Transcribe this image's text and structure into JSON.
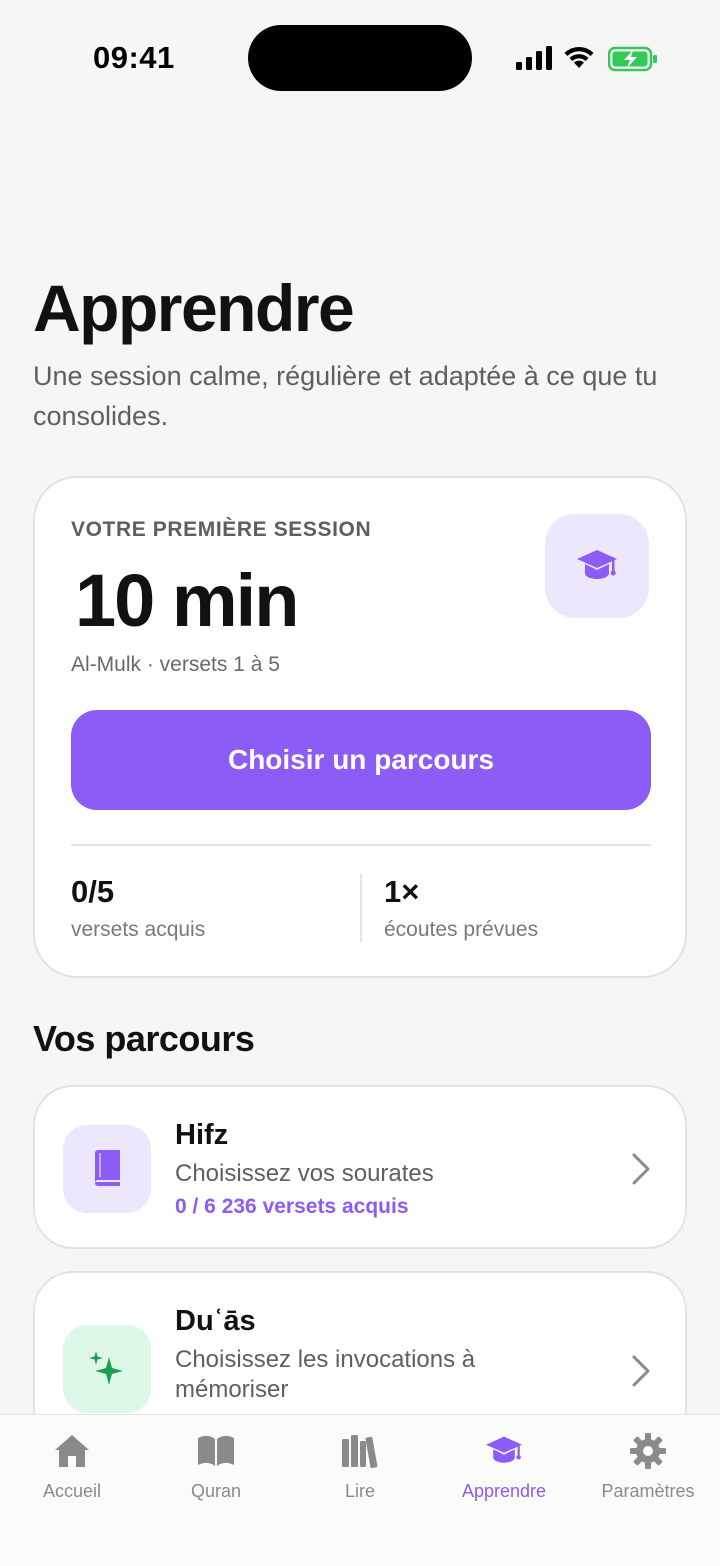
{
  "status_bar": {
    "time": "09:41"
  },
  "header": {
    "title": "Apprendre",
    "subtitle": "Une session calme, régulière et adaptée à ce que tu consolides."
  },
  "session_card": {
    "eyebrow": "VOTRE PREMIÈRE SESSION",
    "duration": "10 min",
    "meta": "Al-Mulk · versets 1 à 5",
    "badge_icon": "graduation-cap-icon",
    "cta_label": "Choisir un parcours",
    "stats": [
      {
        "value": "0/5",
        "label": "versets acquis"
      },
      {
        "value": "1×",
        "label": "écoutes prévues"
      }
    ]
  },
  "parcours": {
    "section_title": "Vos parcours",
    "items": [
      {
        "title": "Hifz",
        "description": "Choisissez vos sourates",
        "progress": "0 / 6 236 versets acquis",
        "icon": "book-icon"
      },
      {
        "title": "Duʿās",
        "description": "Choisissez les invocations à mémoriser",
        "icon": "sparkles-icon"
      }
    ]
  },
  "tab_bar": {
    "tabs": [
      {
        "label": "Accueil",
        "icon": "home-icon",
        "active": false
      },
      {
        "label": "Quran",
        "icon": "open-book-icon",
        "active": false
      },
      {
        "label": "Lire",
        "icon": "library-icon",
        "active": false
      },
      {
        "label": "Apprendre",
        "icon": "graduation-cap-icon",
        "active": true
      },
      {
        "label": "Paramètres",
        "icon": "gear-icon",
        "active": false
      }
    ]
  },
  "colors": {
    "accent": "#8b5cf6",
    "accent_soft": "#ede7fd",
    "green_soft": "#ddf8e6",
    "green_icon": "#1f9d55",
    "battery_green": "#34c759",
    "background": "#f6f6f4"
  }
}
